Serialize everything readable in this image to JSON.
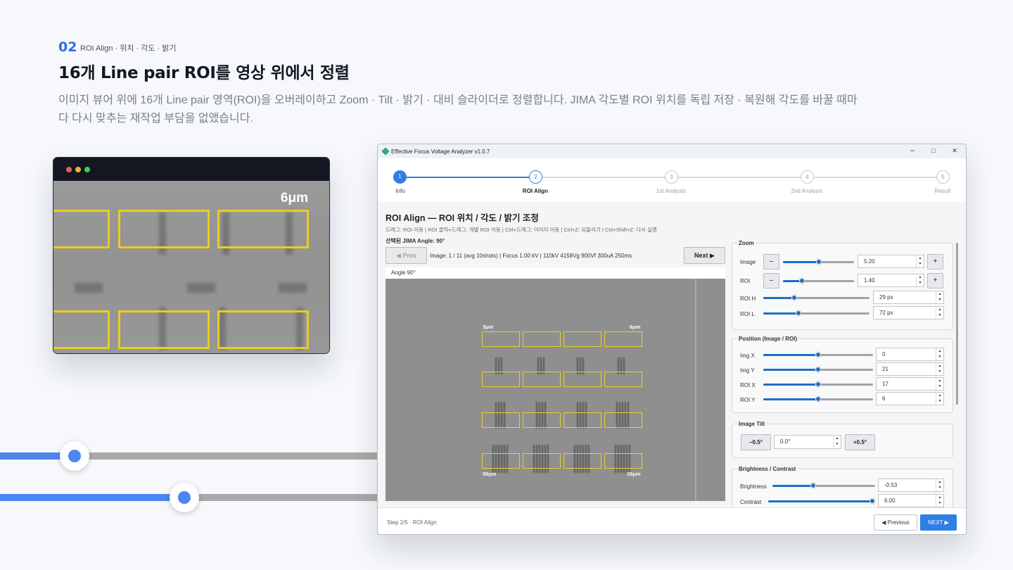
{
  "header": {
    "number": "02",
    "category": "ROI Align · 위치 · 각도 · 밝기",
    "title": "16개 Line pair ROI를 영상 위에서 정렬",
    "description": "이미지 뷰어 위에 16개 Line pair 영역(ROI)을 오버레이하고 Zoom · Tilt · 밝기 · 대비 슬라이더로 정렬합니다. JIMA 각도별 ROI 위치를 독립 저장 · 복원해 각도를 바꿀 때마다 다시 맞추는 재작업 부담을 없앴습니다."
  },
  "preview": {
    "label": "6μm"
  },
  "colors": {
    "accent": "#2f6fe0",
    "roi": "#e9cd1f",
    "slider": "#1d6fc4"
  },
  "app": {
    "title": "Effective Focus Voltage Analyzer v1.0.7",
    "window_buttons": {
      "minimize": "–",
      "maximize": "□",
      "close": "✕"
    },
    "steps": [
      {
        "num": "1",
        "label": "Info"
      },
      {
        "num": "2",
        "label": "ROI Align"
      },
      {
        "num": "3",
        "label": "1st Analysis"
      },
      {
        "num": "4",
        "label": "2nd Analysis"
      },
      {
        "num": "5",
        "label": "Result"
      }
    ],
    "content": {
      "title": "ROI Align — ROI 위치 / 각도 / 밝기 조정",
      "hint": "드래그: ROI 이동 | ROI 클릭+드래그: 개별 ROI 이동 | Ctrl+드래그: 이미지 이동 | Ctrl+Z: 되돌리기 | Ctrl+Shift+Z: 다시 실행",
      "selected_angle": "선택된 JIMA Angle: 90°",
      "prev": "◀ Prev",
      "next": "Next ▶",
      "image_info": "Image: 1 / 11   (avg 10shots)   |   Focus 1.00 kV   |   110kV 4158Vg 900Vf 300uA 250ms",
      "angle_tab": "Angle 90°",
      "roi_labels": {
        "top_left": "3μm",
        "top_right": "6μm",
        "bottom_left": "50μm",
        "bottom_right": "35μm"
      }
    },
    "zoom": {
      "title": "Zoom",
      "image": {
        "label": "Image",
        "value": "5.20",
        "minus": "–",
        "plus": "+",
        "level": 0.5
      },
      "roi": {
        "label": "ROI",
        "value": "1.40",
        "minus": "–",
        "plus": "+",
        "level": 0.27
      },
      "roi_h": {
        "label": "ROI H",
        "value": "29 px",
        "level": 0.29
      },
      "roi_l": {
        "label": "ROI L",
        "value": "72 px",
        "level": 0.33
      }
    },
    "position": {
      "title": "Position (Image / ROI)",
      "img_x": {
        "label": "Img X",
        "value": "0",
        "level": 0.5
      },
      "img_y": {
        "label": "Img Y",
        "value": "21",
        "level": 0.5
      },
      "roi_x": {
        "label": "ROI X",
        "value": "17",
        "level": 0.5
      },
      "roi_y": {
        "label": "ROI Y",
        "value": "6",
        "level": 0.5
      }
    },
    "tilt": {
      "title": "Image Tilt",
      "minus": "−0.5°",
      "value": "0.0°",
      "plus": "+0.5°"
    },
    "brightness": {
      "title": "Brightness / Contrast",
      "brightness": {
        "label": "Brightness",
        "value": "-0.53",
        "level": 0.4
      },
      "contrast": {
        "label": "Contrast",
        "value": "6.00",
        "level": 1.0
      }
    },
    "footer": {
      "step_text": "Step 2/5  ·  ROI Align",
      "prev": "◀ Previous",
      "next": "NEXT ▶"
    }
  }
}
